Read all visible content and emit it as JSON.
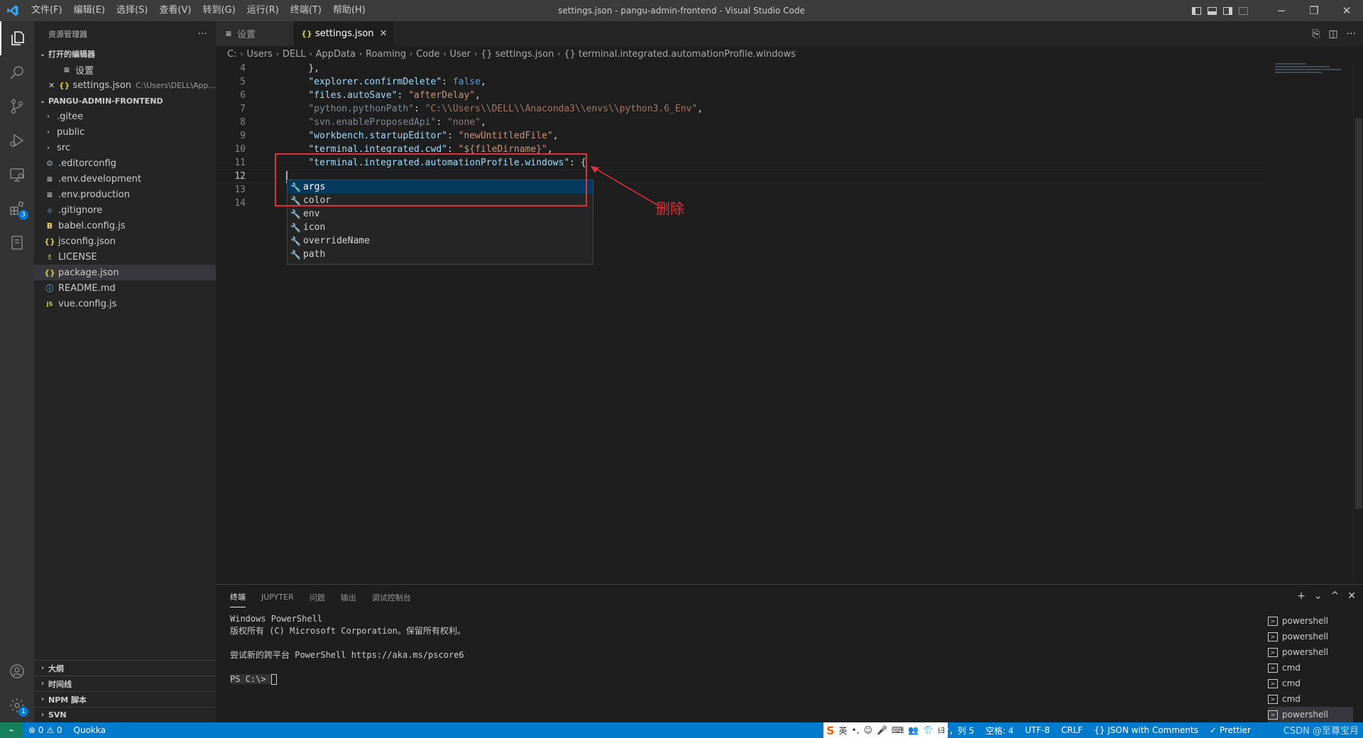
{
  "window": {
    "title": "settings.json - pangu-admin-frontend - Visual Studio Code",
    "menu": [
      "文件(F)",
      "编辑(E)",
      "选择(S)",
      "查看(V)",
      "转到(G)",
      "运行(R)",
      "终端(T)",
      "帮助(H)"
    ],
    "controls": {
      "minimize": "−",
      "maximize": "❐",
      "close": "✕"
    }
  },
  "activity_bar": {
    "extensions_badge": "3",
    "settings_badge": "1"
  },
  "sidebar": {
    "title": "资源管理器",
    "more": "···",
    "open_editors": {
      "header": "打开的编辑器",
      "items": [
        {
          "label": "设置",
          "desc": "",
          "icon": "≡"
        },
        {
          "label": "settings.json",
          "desc": "C:\\Users\\DELL\\App...",
          "icon": "{}",
          "close": "✕"
        }
      ]
    },
    "project": {
      "header": "PANGU-ADMIN-FRONTEND",
      "folders": [
        ".gitee",
        "public",
        "src"
      ],
      "files": [
        {
          "label": ".editorconfig",
          "icon": "⚙",
          "color": "#9aa4b0"
        },
        {
          "label": ".env.development",
          "icon": "≡",
          "color": "#cccccc"
        },
        {
          "label": ".env.production",
          "icon": "≡",
          "color": "#cccccc"
        },
        {
          "label": ".gitignore",
          "icon": "◆",
          "color": "#41535b"
        },
        {
          "label": "babel.config.js",
          "icon": "B",
          "color": "#f5da55"
        },
        {
          "label": "jsconfig.json",
          "icon": "{}",
          "color": "#cbcb41"
        },
        {
          "label": "LICENSE",
          "icon": "♗",
          "color": "#cbcb41"
        },
        {
          "label": "package.json",
          "icon": "{}",
          "color": "#cbcb41",
          "selected": true
        },
        {
          "label": "README.md",
          "icon": "ⓘ",
          "color": "#519aba"
        },
        {
          "label": "vue.config.js",
          "icon": "JS",
          "color": "#cbcb41"
        }
      ]
    },
    "bottom_sections": [
      "大纲",
      "时间线",
      "NPM 脚本",
      "SVN"
    ]
  },
  "editor": {
    "tabs": [
      {
        "label": "设置",
        "icon": "≡",
        "active": false
      },
      {
        "label": "settings.json",
        "icon": "{}",
        "active": true,
        "close": "✕"
      }
    ],
    "breadcrumbs": [
      "C:",
      "Users",
      "DELL",
      "AppData",
      "Roaming",
      "Code",
      "User",
      "{} settings.json",
      "{} terminal.integrated.automationProfile.windows"
    ],
    "lines": [
      {
        "n": "4",
        "tokens": [
          [
            "    ",
            "p"
          ],
          [
            "},",
            "p"
          ]
        ]
      },
      {
        "n": "5",
        "tokens": [
          [
            "    ",
            "p"
          ],
          [
            "\"explorer.confirmDelete\"",
            "k"
          ],
          [
            ": ",
            "p"
          ],
          [
            "false",
            "b"
          ],
          [
            ",",
            "p"
          ]
        ]
      },
      {
        "n": "6",
        "tokens": [
          [
            "    ",
            "p"
          ],
          [
            "\"files.autoSave\"",
            "k"
          ],
          [
            ": ",
            "p"
          ],
          [
            "\"afterDelay\"",
            "s"
          ],
          [
            ",",
            "p"
          ]
        ]
      },
      {
        "n": "7",
        "tokens": [
          [
            "    ",
            "p"
          ],
          [
            "\"python.pythonPath\"",
            "d"
          ],
          [
            ": ",
            "p"
          ],
          [
            "\"C:\\\\Users\\\\DELL\\\\Anaconda3\\\\envs\\\\python3.6_Env\"",
            "ds"
          ],
          [
            ",",
            "p"
          ]
        ]
      },
      {
        "n": "8",
        "tokens": [
          [
            "    ",
            "p"
          ],
          [
            "\"svn.enableProposedApi\"",
            "d"
          ],
          [
            ": ",
            "p"
          ],
          [
            "\"none\"",
            "ds"
          ],
          [
            ",",
            "p"
          ]
        ]
      },
      {
        "n": "9",
        "tokens": [
          [
            "    ",
            "p"
          ],
          [
            "\"workbench.startupEditor\"",
            "k"
          ],
          [
            ": ",
            "p"
          ],
          [
            "\"newUntitledFile\"",
            "s"
          ],
          [
            ",",
            "p"
          ]
        ]
      },
      {
        "n": "10",
        "tokens": [
          [
            "    ",
            "p"
          ],
          [
            "\"terminal.integrated.cwd\"",
            "k"
          ],
          [
            ": ",
            "p"
          ],
          [
            "\"${fileDirname}\"",
            "s"
          ],
          [
            ",",
            "p"
          ]
        ]
      },
      {
        "n": "11",
        "tokens": [
          [
            "    ",
            "p"
          ],
          [
            "\"terminal.integrated.automationProfile.windows\"",
            "k"
          ],
          [
            ": ",
            "p"
          ],
          [
            "{",
            "p"
          ]
        ]
      },
      {
        "n": "12",
        "tokens": [],
        "current": true
      },
      {
        "n": "13",
        "tokens": []
      },
      {
        "n": "14",
        "tokens": [
          [
            "}",
            "p"
          ]
        ]
      }
    ],
    "suggestions": [
      "args",
      "color",
      "env",
      "icon",
      "overrideName",
      "path"
    ],
    "annotation": "删除"
  },
  "panel": {
    "tabs": [
      "终端",
      "JUPYTER",
      "问题",
      "输出",
      "调试控制台"
    ],
    "actions": [
      "+",
      "⌄",
      "^",
      "✕"
    ],
    "terminal_lines": [
      "Windows PowerShell",
      "版权所有 (C) Microsoft Corporation。保留所有权利。",
      "",
      "尝试新的跨平台 PowerShell https://aka.ms/pscore6",
      ""
    ],
    "prompt": "PS C:\\> ",
    "terminals": [
      "powershell",
      "powershell",
      "powershell",
      "cmd",
      "cmd",
      "cmd",
      "powershell"
    ]
  },
  "statusbar": {
    "remote": "⌁",
    "problems": "⊗ 0 ⚠ 0",
    "quokka": "Quokka",
    "ime": [
      "S",
      "英",
      "•,",
      "☺",
      "🎤",
      "⌨",
      "👥",
      "👕",
      "⊞"
    ],
    "position": "行 12，列 5",
    "spaces": "空格: 4",
    "encoding": "UTF-8",
    "eol": "CRLF",
    "language": "{} JSON with Comments",
    "prettier": "✓ Prettier",
    "watermark": "CSDN @至尊宝月"
  }
}
